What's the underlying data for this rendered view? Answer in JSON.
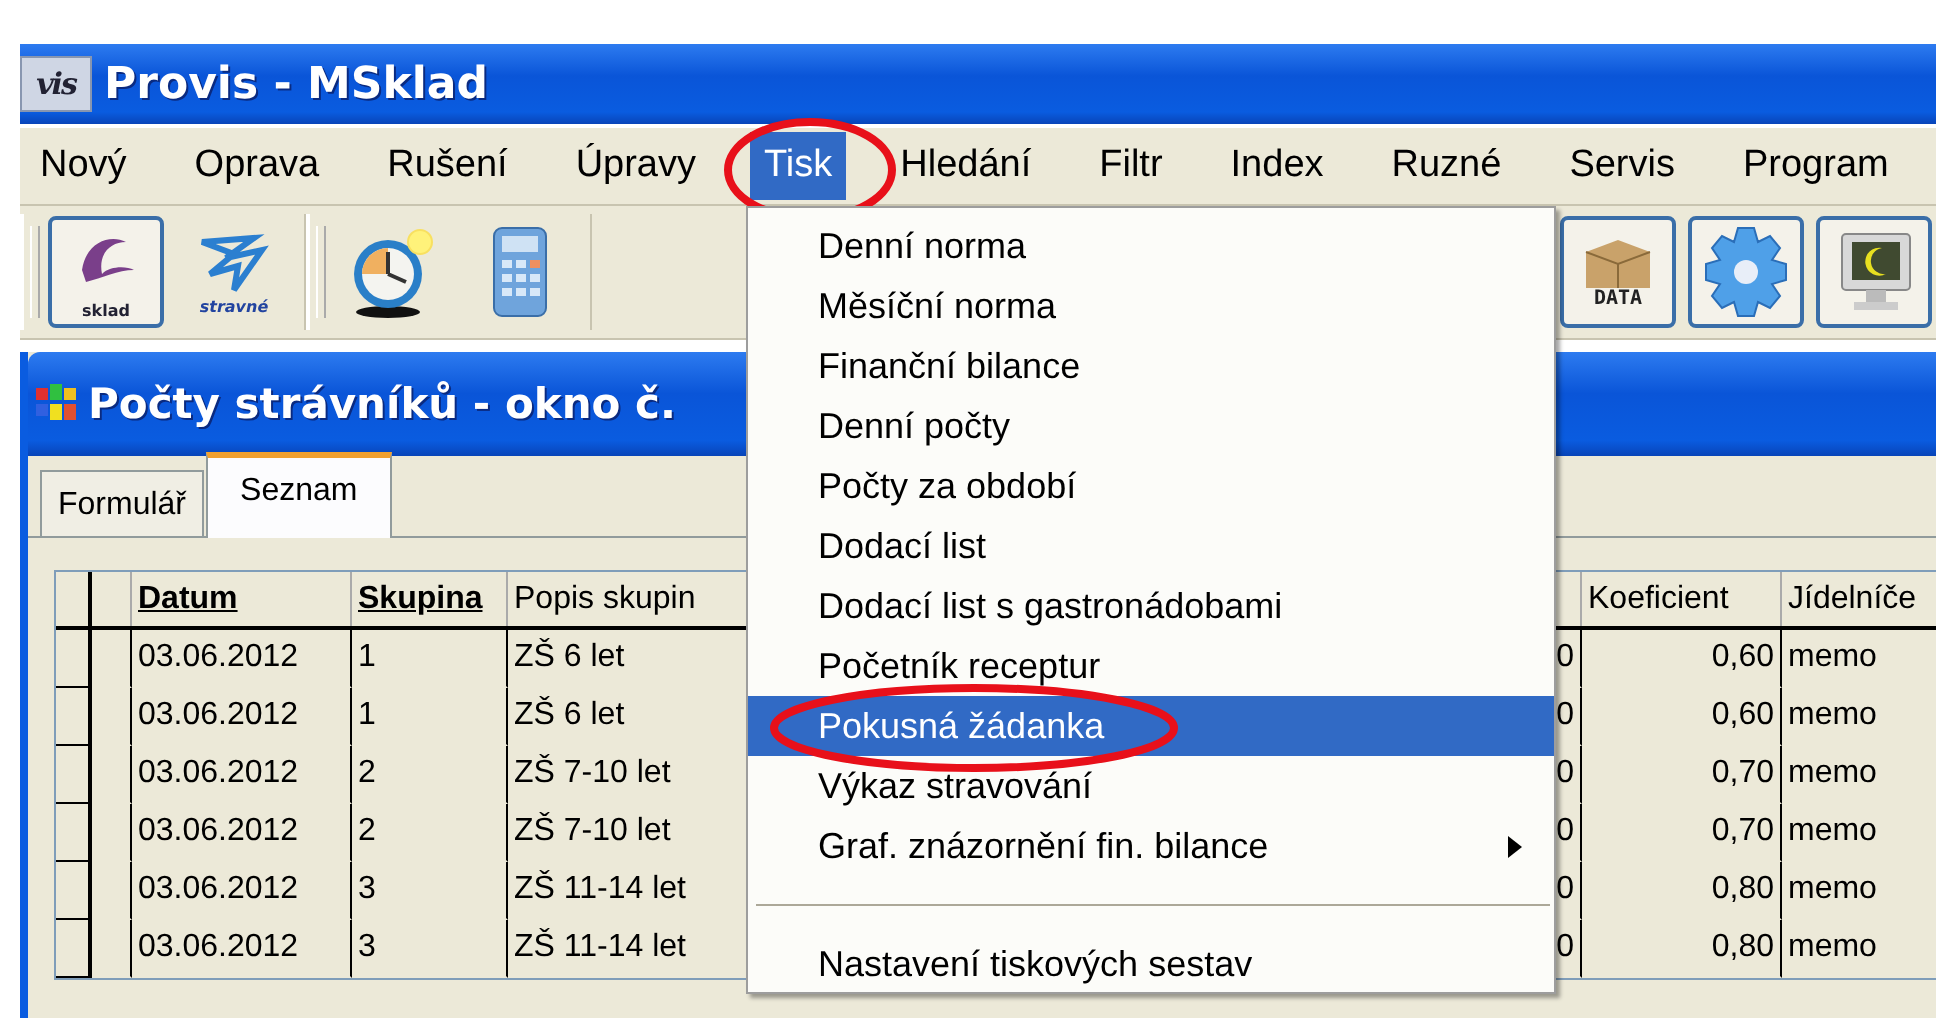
{
  "window": {
    "logo": "vis",
    "title": "Provis - MSklad"
  },
  "menubar": [
    {
      "label": "Nový",
      "selected": false,
      "circled": false
    },
    {
      "label": "Oprava",
      "selected": false,
      "circled": false
    },
    {
      "label": "Rušení",
      "selected": false,
      "circled": false
    },
    {
      "label": "Úpravy",
      "selected": false,
      "circled": false
    },
    {
      "label": "Tisk",
      "selected": true,
      "circled": true
    },
    {
      "label": "Hledání",
      "selected": false,
      "circled": false
    },
    {
      "label": "Filtr",
      "selected": false,
      "circled": false
    },
    {
      "label": "Index",
      "selected": false,
      "circled": false
    },
    {
      "label": "Ruzné",
      "selected": false,
      "circled": false
    },
    {
      "label": "Servis",
      "selected": false,
      "circled": false
    },
    {
      "label": "Program",
      "selected": false,
      "circled": false
    }
  ],
  "toolbar": {
    "left": [
      {
        "kind": "sklad",
        "label": "sklad",
        "pressed": true
      },
      {
        "kind": "stravne",
        "label": "stravné",
        "pressed": false
      }
    ],
    "middle": [
      {
        "kind": "clock",
        "pressed": false
      },
      {
        "kind": "calculator",
        "pressed": false
      }
    ],
    "right": [
      {
        "kind": "data",
        "label": "DATA",
        "pressed": true
      },
      {
        "kind": "gear",
        "pressed": true
      },
      {
        "kind": "monitor",
        "pressed": true
      }
    ]
  },
  "menu": [
    {
      "kind": "item",
      "label": "Denní norma",
      "selected": false,
      "circled": false
    },
    {
      "kind": "item",
      "label": "Měsíční norma",
      "selected": false,
      "circled": false
    },
    {
      "kind": "item",
      "label": "Finanční bilance",
      "selected": false,
      "circled": false
    },
    {
      "kind": "item",
      "label": "Denní počty",
      "selected": false,
      "circled": false
    },
    {
      "kind": "item",
      "label": "Počty za období",
      "selected": false,
      "circled": false
    },
    {
      "kind": "item",
      "label": "Dodací list",
      "selected": false,
      "circled": false
    },
    {
      "kind": "item",
      "label": "Dodací list s gastronádobami",
      "selected": false,
      "circled": false
    },
    {
      "kind": "item",
      "label": "Početník receptur",
      "selected": false,
      "circled": false
    },
    {
      "kind": "item",
      "label": "Pokusná žádanka",
      "selected": true,
      "circled": true
    },
    {
      "kind": "item",
      "label": "Výkaz stravování",
      "selected": false,
      "circled": false
    },
    {
      "kind": "submenu",
      "label": "Graf. znázornění fin. bilance",
      "selected": false,
      "circled": false
    },
    {
      "kind": "separator"
    },
    {
      "kind": "item",
      "label": "Nastavení tiskových sestav",
      "selected": false,
      "circled": false
    }
  ],
  "child_window": {
    "title": "Počty strávníků - okno č.",
    "tabs": [
      {
        "label": "Formulář",
        "selected": false
      },
      {
        "label": "Seznam",
        "selected": true
      }
    ],
    "table": {
      "columns": [
        {
          "label": "Datum",
          "sorted": true
        },
        {
          "label": "Skupina",
          "sorted": true
        },
        {
          "label": "Popis skupin",
          "sorted": false
        },
        {},
        {
          "label": "Koeficient",
          "sorted": false
        },
        {
          "label": "Jídelníče",
          "sorted": false
        }
      ],
      "rows": [
        [
          "03.06.2012",
          "1",
          "ZŠ 6 let",
          "0",
          "0,60",
          "memo"
        ],
        [
          "03.06.2012",
          "1",
          "ZŠ 6 let",
          "0",
          "0,60",
          "memo"
        ],
        [
          "03.06.2012",
          "2",
          "ZŠ 7-10 let",
          "0",
          "0,70",
          "memo"
        ],
        [
          "03.06.2012",
          "2",
          "ZŠ 7-10 let",
          "0",
          "0,70",
          "memo"
        ],
        [
          "03.06.2012",
          "3",
          "ZŠ 11-14 let",
          "0",
          "0,80",
          "memo"
        ],
        [
          "03.06.2012",
          "3",
          "ZŠ 11-14 let",
          "0",
          "0,80",
          "memo"
        ]
      ]
    }
  }
}
